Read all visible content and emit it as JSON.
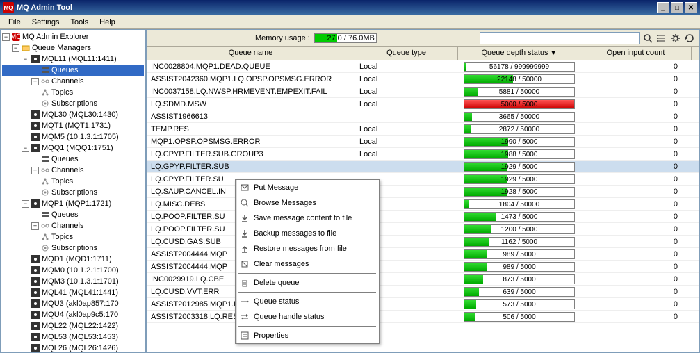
{
  "titlebar": {
    "icon_text": "MQ",
    "title": "MQ Admin Tool"
  },
  "menubar": [
    "File",
    "Settings",
    "Tools",
    "Help"
  ],
  "toolbar": {
    "memory_label": "Memory usage :",
    "memory_value": "27",
    "memory_suffix": ".0 / 76.0MB",
    "memory_pct": 36,
    "search_placeholder": ""
  },
  "tree": {
    "root": "MQ Admin Explorer",
    "qm_root": "Queue Managers",
    "nodes": [
      {
        "label": "MQL11 (MQL11:1411)",
        "indent": 2,
        "expanded": true,
        "icon": "qm",
        "children": [
          {
            "label": "Queues",
            "icon": "q",
            "selected": true
          },
          {
            "label": "Channels",
            "icon": "ch",
            "expandable": true
          },
          {
            "label": "Topics",
            "icon": "tp"
          },
          {
            "label": "Subscriptions",
            "icon": "sub"
          }
        ]
      },
      {
        "label": "MQL30 (MQL30:1430)",
        "indent": 2,
        "icon": "qm"
      },
      {
        "label": "MQT1 (MQT1:1731)",
        "indent": 2,
        "icon": "qm"
      },
      {
        "label": "MQM5 (10.1.3.1:1705)",
        "indent": 2,
        "icon": "qm"
      },
      {
        "label": "MQQ1 (MQQ1:1751)",
        "indent": 2,
        "expanded": true,
        "icon": "qm",
        "children": [
          {
            "label": "Queues",
            "icon": "q"
          },
          {
            "label": "Channels",
            "icon": "ch",
            "expandable": true
          },
          {
            "label": "Topics",
            "icon": "tp"
          },
          {
            "label": "Subscriptions",
            "icon": "sub"
          }
        ]
      },
      {
        "label": "MQP1 (MQP1:1721)",
        "indent": 2,
        "expanded": true,
        "icon": "qm",
        "children": [
          {
            "label": "Queues",
            "icon": "q"
          },
          {
            "label": "Channels",
            "icon": "ch",
            "expandable": true
          },
          {
            "label": "Topics",
            "icon": "tp"
          },
          {
            "label": "Subscriptions",
            "icon": "sub"
          }
        ]
      },
      {
        "label": "MQD1 (MQD1:1711)",
        "indent": 2,
        "icon": "qm"
      },
      {
        "label": "MQM0 (10.1.2.1:1700)",
        "indent": 2,
        "icon": "qm"
      },
      {
        "label": "MQM3 (10.1.3.1:1701)",
        "indent": 2,
        "icon": "qm"
      },
      {
        "label": "MQL41 (MQL41:1441)",
        "indent": 2,
        "icon": "qm"
      },
      {
        "label": "MQU3 (akl0ap857:170",
        "indent": 2,
        "icon": "qm"
      },
      {
        "label": "MQU4 (akl0ap9c5:170",
        "indent": 2,
        "icon": "qm"
      },
      {
        "label": "MQL22 (MQL22:1422)",
        "indent": 2,
        "icon": "qm"
      },
      {
        "label": "MQL53 (MQL53:1453)",
        "indent": 2,
        "icon": "qm"
      },
      {
        "label": "MQL26 (MQL26:1426)",
        "indent": 2,
        "icon": "qm"
      }
    ]
  },
  "table": {
    "columns": [
      "Queue name",
      "Queue type",
      "Queue depth status",
      "Open input count"
    ],
    "sort_col": 2,
    "rows": [
      {
        "name": "INC0028804.MQP1.DEAD.QUEUE",
        "type": "Local",
        "depth": 56178,
        "max": 999999999,
        "open": 0,
        "pct": 1,
        "color": "green"
      },
      {
        "name": "ASSIST2042360.MQP1.LQ.OPSP.OPSMSG.ERROR",
        "type": "Local",
        "depth": 22148,
        "max": 50000,
        "open": 0,
        "pct": 44,
        "color": "green"
      },
      {
        "name": "INC0037158.LQ.NWSP.HRMEVENT.EMPEXIT.FAIL",
        "type": "Local",
        "depth": 5881,
        "max": 50000,
        "open": 0,
        "pct": 12,
        "color": "green"
      },
      {
        "name": "LQ.SDMD.MSW",
        "type": "Local",
        "depth": 5000,
        "max": 5000,
        "open": 0,
        "pct": 100,
        "color": "red"
      },
      {
        "name": "ASSIST1966613",
        "type": "",
        "depth": 3665,
        "max": 50000,
        "open": 0,
        "pct": 7,
        "color": "green"
      },
      {
        "name": "TEMP.RES",
        "type": "Local",
        "depth": 2872,
        "max": 50000,
        "open": 0,
        "pct": 6,
        "color": "green"
      },
      {
        "name": "MQP1.OPSP.OPSMSG.ERROR",
        "type": "Local",
        "depth": 1990,
        "max": 5000,
        "open": 0,
        "pct": 40,
        "color": "green"
      },
      {
        "name": "LQ.CPYP.FILTER.SUB.GROUP3",
        "type": "Local",
        "depth": 1988,
        "max": 5000,
        "open": 0,
        "pct": 40,
        "color": "green"
      },
      {
        "name": "LQ.GPYP.FILTER.SUB",
        "type": "",
        "depth": 1929,
        "max": 5000,
        "open": 0,
        "pct": 39,
        "color": "green",
        "selected": true
      },
      {
        "name": "LQ.CPYP.FILTER.SU",
        "type": "",
        "depth": 1929,
        "max": 5000,
        "open": 0,
        "pct": 39,
        "color": "green"
      },
      {
        "name": "LQ.SAUP.CANCEL.IN",
        "type": "",
        "depth": 1928,
        "max": 5000,
        "open": 0,
        "pct": 39,
        "color": "green"
      },
      {
        "name": "LQ.MISC.DEBS",
        "type": "",
        "depth": 1804,
        "max": 50000,
        "open": 0,
        "pct": 4,
        "color": "green"
      },
      {
        "name": "LQ.POOP.FILTER.SU",
        "type": "",
        "depth": 1473,
        "max": 5000,
        "open": 0,
        "pct": 29,
        "color": "green"
      },
      {
        "name": "LQ.POOP.FILTER.SU",
        "type": "",
        "depth": 1200,
        "max": 5000,
        "open": 0,
        "pct": 24,
        "color": "green"
      },
      {
        "name": "LQ.CUSD.GAS.SUB",
        "type": "",
        "depth": 1162,
        "max": 5000,
        "open": 0,
        "pct": 23,
        "color": "green"
      },
      {
        "name": "ASSIST2004444.MQP",
        "type": "",
        "depth": 989,
        "max": 5000,
        "open": 0,
        "pct": 20,
        "color": "green"
      },
      {
        "name": "ASSIST2004444.MQP",
        "type": "",
        "depth": 989,
        "max": 5000,
        "open": 0,
        "pct": 20,
        "color": "green"
      },
      {
        "name": "INC0029919.LQ.CBE",
        "type": "",
        "depth": 873,
        "max": 5000,
        "open": 0,
        "pct": 17,
        "color": "green"
      },
      {
        "name": "LQ.CUSD.VVT.ERR",
        "type": "",
        "depth": 639,
        "max": 5000,
        "open": 0,
        "pct": 13,
        "color": "green"
      },
      {
        "name": "ASSIST2012985.MQP1.ESSP.SALEVENT.EMD.FAIL",
        "type": "Local",
        "depth": 573,
        "max": 5000,
        "open": 0,
        "pct": 11,
        "color": "green"
      },
      {
        "name": "ASSIST2003318.LQ.RESP.OPSEVENT.ROSTERBE",
        "type": "Local",
        "depth": 506,
        "max": 5000,
        "open": 0,
        "pct": 10,
        "color": "green"
      }
    ]
  },
  "context_menu": [
    {
      "icon": "put",
      "label": "Put Message"
    },
    {
      "icon": "browse",
      "label": "Browse Messages"
    },
    {
      "icon": "save",
      "label": "Save message content to file"
    },
    {
      "icon": "backup",
      "label": "Backup messages to file"
    },
    {
      "icon": "restore",
      "label": "Restore messages from file"
    },
    {
      "icon": "clear",
      "label": "Clear messages"
    },
    {
      "sep": true
    },
    {
      "icon": "delete",
      "label": "Delete queue"
    },
    {
      "sep": true
    },
    {
      "icon": "status",
      "label": "Queue status"
    },
    {
      "icon": "handle",
      "label": "Queue handle status"
    },
    {
      "sep": true
    },
    {
      "icon": "props",
      "label": "Properties"
    }
  ]
}
